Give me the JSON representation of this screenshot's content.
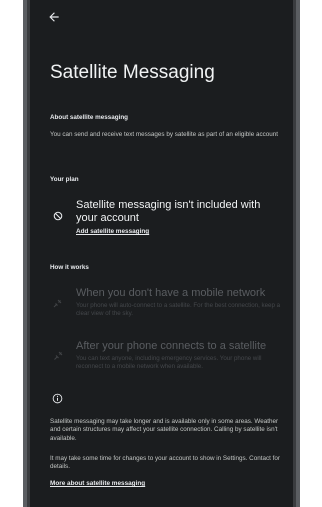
{
  "header": {
    "back_icon": "arrow-back-icon",
    "title": "Satellite Messaging"
  },
  "about": {
    "heading": "About satellite messaging",
    "text": "You can send and receive text messages by satellite as part of an eligible  account"
  },
  "plan": {
    "heading": "Your plan",
    "icon": "no-entry-icon",
    "title": "Satellite messaging isn't included with your account",
    "link": "Add satellite messaging"
  },
  "how": {
    "heading": "How it works",
    "items": [
      {
        "icon": "satellite-icon",
        "title": "When you don't have a mobile network",
        "subtitle": "Your phone will auto-connect to a satellite. For the best connection, keep a clear view of the sky."
      },
      {
        "icon": "satellite-connect-icon",
        "title": "After your phone connects to a satellite",
        "subtitle": "You can text anyone, including emergency services. Your phone will reconnect to a mobile network when available."
      }
    ]
  },
  "info": {
    "icon": "info-icon",
    "text1": "Satellite messaging may take longer and is available only in some areas. Weather and certain structures may affect your satellite connection. Calling by satellite isn't available.",
    "text2": "It may take some time for changes to your account to show in Settings. Contact  for details.",
    "link": "More about satellite messaging"
  }
}
